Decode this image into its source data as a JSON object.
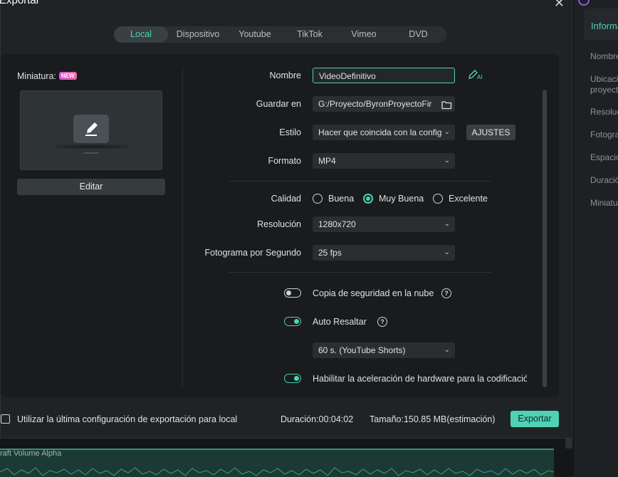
{
  "dialog": {
    "title": "Exportar",
    "close_icon": "close-icon"
  },
  "tabs": [
    {
      "label": "Local",
      "active": true
    },
    {
      "label": "Dispositivo",
      "active": false
    },
    {
      "label": "Youtube",
      "active": false
    },
    {
      "label": "TikTok",
      "active": false
    },
    {
      "label": "Vimeo",
      "active": false
    },
    {
      "label": "DVD",
      "active": false
    }
  ],
  "thumbnail": {
    "label": "Miniatura:",
    "badge": "NEW",
    "edit_label": "Editar",
    "icon": "pencil-icon"
  },
  "form": {
    "name_label": "Nombre",
    "name_value": "VideoDefinitivo",
    "save_label": "Guardar en",
    "save_value": "G:/Proyecto/ByronProyectoFir",
    "style_label": "Estilo",
    "style_value": "Hacer que coincida con la config",
    "adjust_label": "AJUSTES",
    "format_label": "Formato",
    "format_value": "MP4",
    "quality_label": "Calidad",
    "quality_options": [
      "Buena",
      "Muy Buena",
      "Excelente"
    ],
    "quality_selected": "Muy Buena",
    "resolution_label": "Resolución",
    "resolution_value": "1280x720",
    "fps_label": "Fotograma por Segundo",
    "fps_value": "25 fps",
    "backup_label": "Copia de seguridad en la nube",
    "backup_on": false,
    "highlight_label": "Auto Resaltar",
    "highlight_on": true,
    "highlight_value": "60 s. (YouTube Shorts)",
    "hw_label": "Habilitar la aceleración de hardware para la codificación d",
    "hw_on": true
  },
  "footer": {
    "checkbox_label": "Utilizar la última configuración de exportación para local",
    "duration": "Duración:00:04:02",
    "size": "Tamaño:150.85 MB(estimación)",
    "export_label": "Exportar"
  },
  "right_panel": {
    "tab": "Informa",
    "labels": [
      "Nombre",
      "Ubicaci",
      "proyect",
      "Resoluc",
      "Fotogra",
      "Espacio",
      "Duració",
      "Miniatu"
    ]
  },
  "timeline": {
    "clip_label": "raft Volume Alpha"
  },
  "colors": {
    "accent": "#4fd1b4",
    "background": "#202325",
    "panel": "#191b1d"
  }
}
